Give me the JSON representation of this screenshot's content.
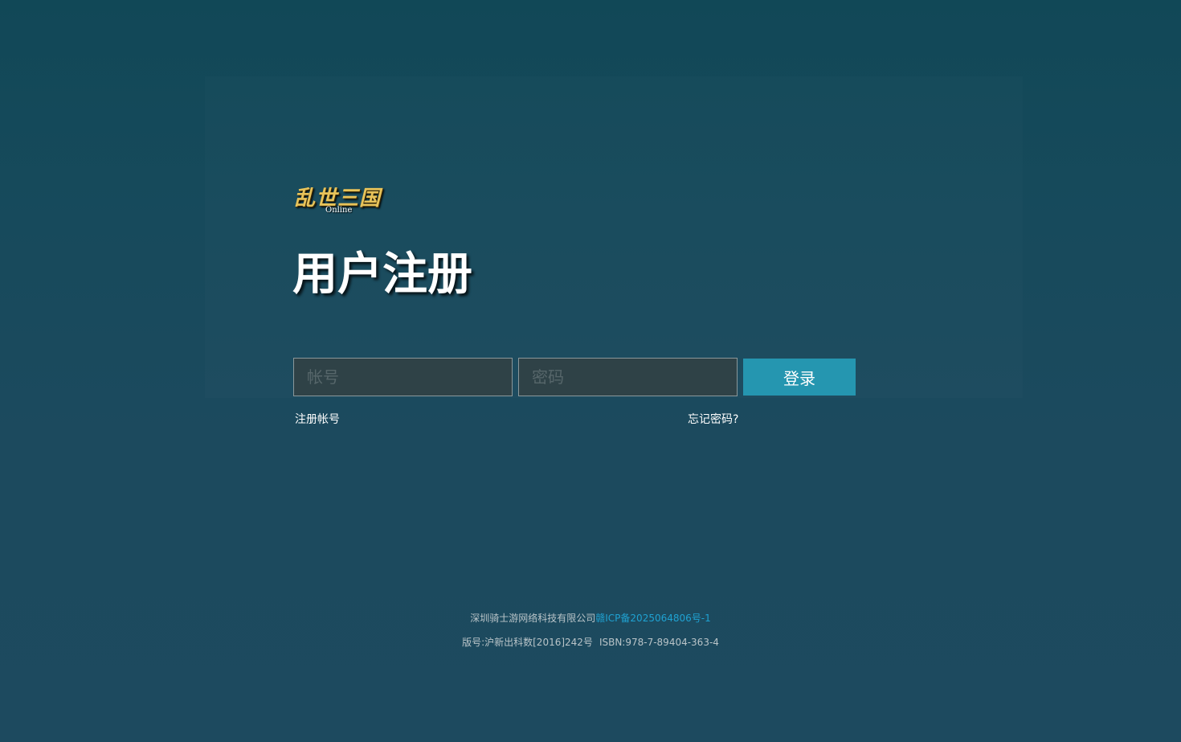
{
  "logo": {
    "text_cn": "乱世三国",
    "text_en": "Online"
  },
  "page": {
    "title": "用户注册"
  },
  "form": {
    "account_placeholder": "帐号",
    "password_placeholder": "密码",
    "login_label": "登录",
    "register_link": "注册帐号",
    "forgot_link": "忘记密码?"
  },
  "footer": {
    "company": "深圳骑士游网络科技有限公司",
    "icp": "赣ICP备2025064806号-1",
    "publish_no": "版号:沪新出科数[2016]242号",
    "isbn": "ISBN:978-7-89404-363-4"
  }
}
